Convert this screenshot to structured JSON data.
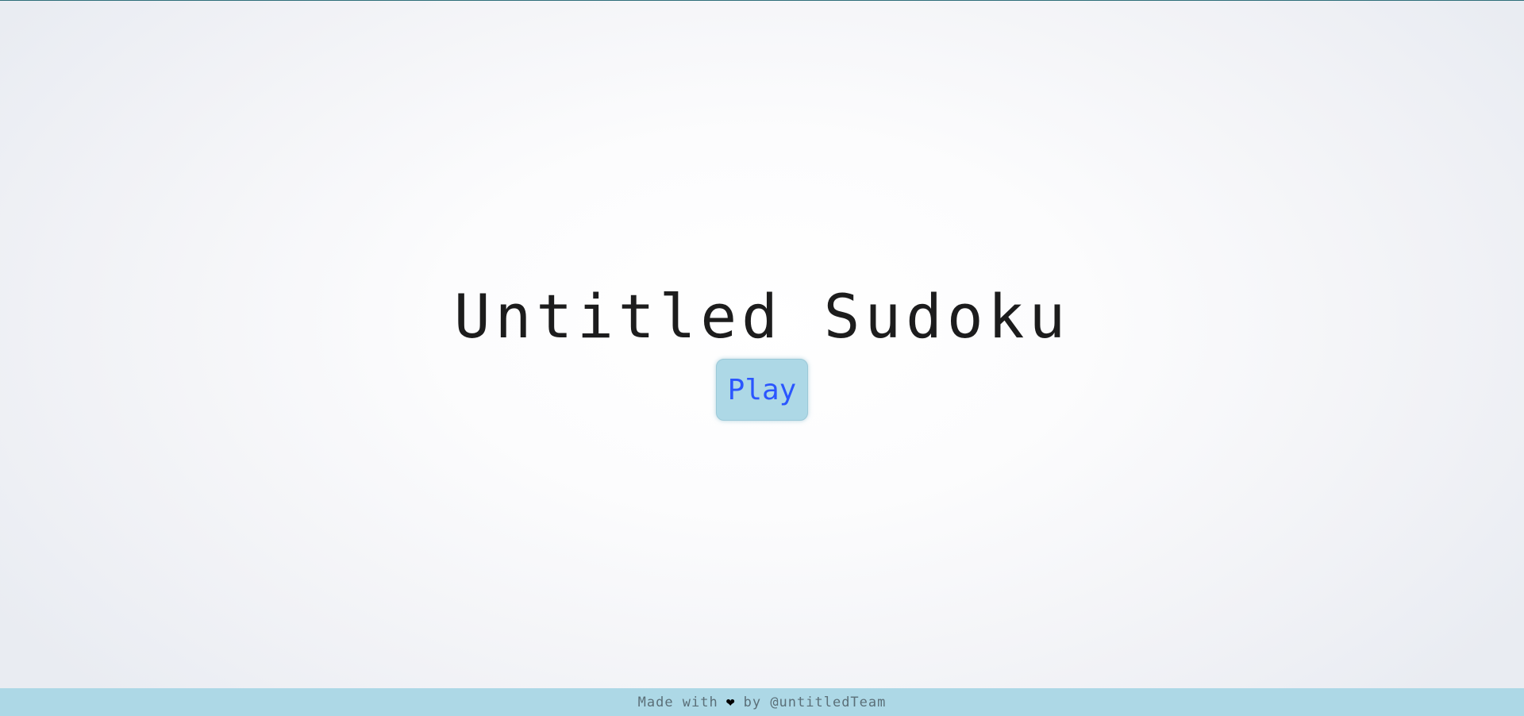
{
  "page": {
    "title": "Untitled Sudoku"
  },
  "main": {
    "play_label": "Play"
  },
  "footer": {
    "prefix": "Made with",
    "heart_icon": "heart-icon",
    "suffix": "by",
    "handle": "@untitledTeam"
  },
  "colors": {
    "accent_bg": "#add8e6",
    "play_text": "#2b56ff",
    "top_line": "#2f6f7a"
  }
}
